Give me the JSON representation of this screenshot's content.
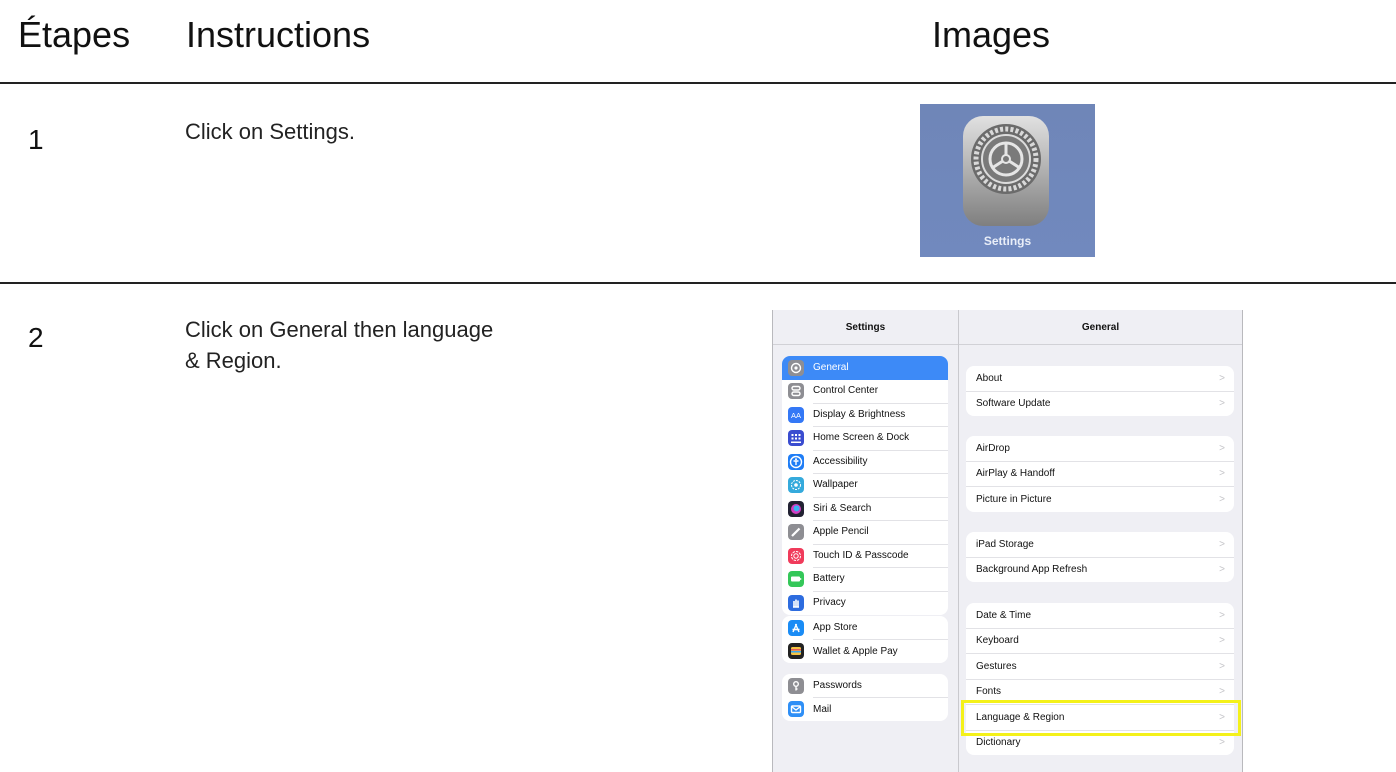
{
  "headers": {
    "steps": "Étapes",
    "instructions": "Instructions",
    "images": "Images"
  },
  "steps": [
    {
      "number": "1",
      "instruction": "Click on Settings."
    },
    {
      "number": "2",
      "instruction": "Click on General then language\n& Region."
    }
  ],
  "settings_icon": {
    "label": "Settings"
  },
  "ipad": {
    "sidebar_title": "Settings",
    "detail_title": "General",
    "sidebar_groups": [
      [
        {
          "label": "General",
          "icon": "gear-icon",
          "color": "#8e8e93",
          "selected": true
        },
        {
          "label": "Control Center",
          "icon": "toggle-icon",
          "color": "#8e8e93"
        },
        {
          "label": "Display & Brightness",
          "icon": "aa-icon",
          "color": "#3478f6"
        },
        {
          "label": "Home Screen & Dock",
          "icon": "grid-icon",
          "color": "#3a4cd0"
        },
        {
          "label": "Accessibility",
          "icon": "accessibility-icon",
          "color": "#1f7df6"
        },
        {
          "label": "Wallpaper",
          "icon": "flower-icon",
          "color": "#35aadc"
        },
        {
          "label": "Siri & Search",
          "icon": "siri-icon",
          "color": "#222233"
        },
        {
          "label": "Apple Pencil",
          "icon": "pencil-icon",
          "color": "#8e8e93"
        },
        {
          "label": "Touch ID & Passcode",
          "icon": "fingerprint-icon",
          "color": "#f03b5b"
        },
        {
          "label": "Battery",
          "icon": "battery-icon",
          "color": "#34c759"
        },
        {
          "label": "Privacy",
          "icon": "hand-icon",
          "color": "#2d6cdf"
        }
      ],
      [
        {
          "label": "App Store",
          "icon": "appstore-icon",
          "color": "#1a8cf5"
        },
        {
          "label": "Wallet & Apple Pay",
          "icon": "wallet-icon",
          "color": "#222222"
        }
      ],
      [
        {
          "label": "Passwords",
          "icon": "key-icon",
          "color": "#8e8e93"
        },
        {
          "label": "Mail",
          "icon": "mail-icon",
          "color": "#2f8ff6"
        }
      ]
    ],
    "detail_groups": [
      [
        "About",
        "Software Update"
      ],
      [
        "AirDrop",
        "AirPlay & Handoff",
        "Picture in Picture"
      ],
      [
        "iPad Storage",
        "Background App Refresh"
      ],
      [
        "Date & Time",
        "Keyboard",
        "Gestures",
        "Fonts",
        "Language & Region",
        "Dictionary"
      ]
    ],
    "chevron": ">",
    "highlight_color": "#f4f11a"
  }
}
